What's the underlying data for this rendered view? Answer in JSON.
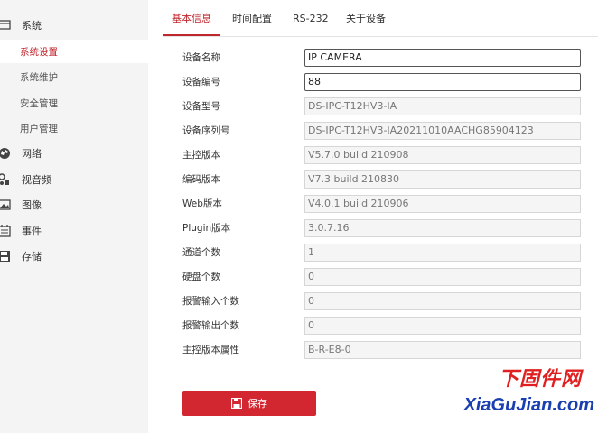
{
  "sidebar": {
    "items": [
      {
        "label": "系统",
        "icon": "monitor-icon"
      },
      {
        "label": "系统设置",
        "active": true
      },
      {
        "label": "系统维护"
      },
      {
        "label": "安全管理"
      },
      {
        "label": "用户管理"
      },
      {
        "label": "网络",
        "icon": "globe-icon"
      },
      {
        "label": "视音频",
        "icon": "audio-video-icon"
      },
      {
        "label": "图像",
        "icon": "image-icon"
      },
      {
        "label": "事件",
        "icon": "calendar-icon"
      },
      {
        "label": "存储",
        "icon": "save-icon"
      }
    ]
  },
  "tabs": [
    {
      "label": "基本信息",
      "active": true
    },
    {
      "label": "时间配置"
    },
    {
      "label": "RS-232"
    },
    {
      "label": "关于设备"
    }
  ],
  "form": {
    "fields": [
      {
        "label": "设备名称",
        "value": "IP CAMERA",
        "editable": true
      },
      {
        "label": "设备编号",
        "value": "88",
        "editable": true
      },
      {
        "label": "设备型号",
        "value": "DS-IPC-T12HV3-IA"
      },
      {
        "label": "设备序列号",
        "value": "DS-IPC-T12HV3-IA20211010AACHG85904123"
      },
      {
        "label": "主控版本",
        "value": "V5.7.0 build 210908"
      },
      {
        "label": "编码版本",
        "value": "V7.3 build 210830"
      },
      {
        "label": "Web版本",
        "value": "V4.0.1 build 210906"
      },
      {
        "label": "Plugin版本",
        "value": "3.0.7.16"
      },
      {
        "label": "通道个数",
        "value": "1"
      },
      {
        "label": "硬盘个数",
        "value": "0"
      },
      {
        "label": "报警输入个数",
        "value": "0"
      },
      {
        "label": "报警输出个数",
        "value": "0"
      },
      {
        "label": "主控版本属性",
        "value": "B-R-E8-0"
      }
    ]
  },
  "save_button": {
    "label": "保存",
    "icon": "save-icon"
  },
  "watermark": {
    "line1": "下固件网",
    "line2": "XiaGuJian.com"
  },
  "colors": {
    "accent": "#c0272d",
    "button": "#d22630",
    "sidebar_bg": "#f4f4f4"
  }
}
